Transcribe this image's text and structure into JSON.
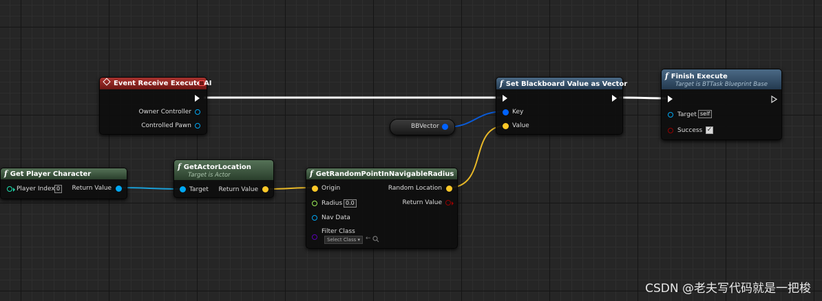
{
  "nodes": {
    "event_receive_execute_ai": {
      "title": "Event Receive Execute AI",
      "pins": {
        "owner_controller": "Owner Controller",
        "controlled_pawn": "Controlled Pawn"
      }
    },
    "set_blackboard_value_as_vector": {
      "title": "Set Blackboard Value as Vector",
      "pins": {
        "key": "Key",
        "value": "Value"
      }
    },
    "finish_execute": {
      "title": "Finish Execute",
      "subtitle": "Target is BTTask Blueprint Base",
      "pins": {
        "target": "Target",
        "target_default": "self",
        "success": "Success"
      },
      "success_checked": true
    },
    "bb_vector": {
      "title": "BBVector"
    },
    "get_player_character": {
      "title": "Get Player Character",
      "pins": {
        "player_index": "Player Index",
        "player_index_value": "0",
        "return_value": "Return Value"
      }
    },
    "get_actor_location": {
      "title": "GetActorLocation",
      "subtitle": "Target is Actor",
      "pins": {
        "target": "Target",
        "return_value": "Return Value"
      }
    },
    "get_random_point": {
      "title": "GetRandomPointInNavigableRadius",
      "pins": {
        "origin": "Origin",
        "radius": "Radius",
        "radius_value": "0.0",
        "nav_data": "Nav Data",
        "filter_class": "Filter Class",
        "filter_class_select": "Select Class",
        "random_location": "Random Location",
        "return_value": "Return Value"
      }
    }
  },
  "function_glyph": "f",
  "watermark": "CSDN @老夫写代码就是一把梭",
  "colors": {
    "exec": "#ffffff",
    "object_pin": "#00a8f4",
    "vector_pin": "#fdc828",
    "float_pin": "#9cf058",
    "bool_pin": "#950000",
    "class_pin": "#5a00b4",
    "blackboard_key": "#0062ff",
    "event_header": "#a8322e",
    "function_header": "#4b6a86",
    "pure_header": "#557257"
  }
}
